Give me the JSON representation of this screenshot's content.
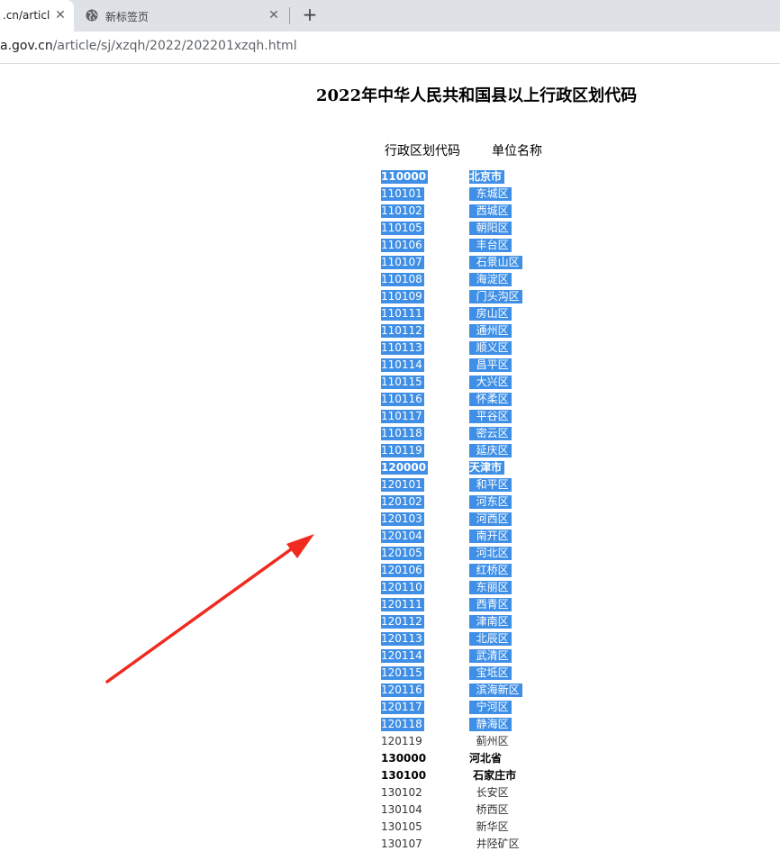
{
  "browser": {
    "tabs": [
      {
        "title": ".cn/articl",
        "active": true
      },
      {
        "title": "新标签页",
        "active": false
      }
    ],
    "new_tab_label": "+",
    "url_host": "a.gov.cn",
    "url_path": "/article/sj/xzqh/2022/202201xzqh.html"
  },
  "page": {
    "title": "2022年中华人民共和国县以上行政区划代码",
    "header_code": "行政区划代码",
    "header_name": "单位名称"
  },
  "rows": [
    {
      "code": "110000",
      "name": "北京市",
      "bold": true,
      "selected": true
    },
    {
      "code": "110101",
      "name": "  东城区",
      "bold": false,
      "selected": true
    },
    {
      "code": "110102",
      "name": "  西城区",
      "bold": false,
      "selected": true
    },
    {
      "code": "110105",
      "name": "  朝阳区",
      "bold": false,
      "selected": true
    },
    {
      "code": "110106",
      "name": "  丰台区",
      "bold": false,
      "selected": true
    },
    {
      "code": "110107",
      "name": "  石景山区",
      "bold": false,
      "selected": true
    },
    {
      "code": "110108",
      "name": "  海淀区",
      "bold": false,
      "selected": true
    },
    {
      "code": "110109",
      "name": "  门头沟区",
      "bold": false,
      "selected": true
    },
    {
      "code": "110111",
      "name": "  房山区",
      "bold": false,
      "selected": true
    },
    {
      "code": "110112",
      "name": "  通州区",
      "bold": false,
      "selected": true
    },
    {
      "code": "110113",
      "name": "  顺义区",
      "bold": false,
      "selected": true
    },
    {
      "code": "110114",
      "name": "  昌平区",
      "bold": false,
      "selected": true
    },
    {
      "code": "110115",
      "name": "  大兴区",
      "bold": false,
      "selected": true
    },
    {
      "code": "110116",
      "name": "  怀柔区",
      "bold": false,
      "selected": true
    },
    {
      "code": "110117",
      "name": "  平谷区",
      "bold": false,
      "selected": true
    },
    {
      "code": "110118",
      "name": "  密云区",
      "bold": false,
      "selected": true
    },
    {
      "code": "110119",
      "name": "  延庆区",
      "bold": false,
      "selected": true
    },
    {
      "code": "120000",
      "name": "天津市",
      "bold": true,
      "selected": true
    },
    {
      "code": "120101",
      "name": "  和平区",
      "bold": false,
      "selected": true
    },
    {
      "code": "120102",
      "name": "  河东区",
      "bold": false,
      "selected": true
    },
    {
      "code": "120103",
      "name": "  河西区",
      "bold": false,
      "selected": true
    },
    {
      "code": "120104",
      "name": "  南开区",
      "bold": false,
      "selected": true
    },
    {
      "code": "120105",
      "name": "  河北区",
      "bold": false,
      "selected": true
    },
    {
      "code": "120106",
      "name": "  红桥区",
      "bold": false,
      "selected": true
    },
    {
      "code": "120110",
      "name": "  东丽区",
      "bold": false,
      "selected": true
    },
    {
      "code": "120111",
      "name": "  西青区",
      "bold": false,
      "selected": true
    },
    {
      "code": "120112",
      "name": "  津南区",
      "bold": false,
      "selected": true
    },
    {
      "code": "120113",
      "name": "  北辰区",
      "bold": false,
      "selected": true
    },
    {
      "code": "120114",
      "name": "  武清区",
      "bold": false,
      "selected": true
    },
    {
      "code": "120115",
      "name": "  宝坻区",
      "bold": false,
      "selected": true
    },
    {
      "code": "120116",
      "name": "  滨海新区",
      "bold": false,
      "selected": true
    },
    {
      "code": "120117",
      "name": "  宁河区",
      "bold": false,
      "selected": true
    },
    {
      "code": "120118",
      "name": "  静海区",
      "bold": false,
      "selected": true
    },
    {
      "code": "120119",
      "name": "  蓟州区",
      "bold": false,
      "selected": false
    },
    {
      "code": "130000",
      "name": "河北省",
      "bold": true,
      "selected": false
    },
    {
      "code": "130100",
      "name": " 石家庄市",
      "bold": true,
      "selected": false
    },
    {
      "code": "130102",
      "name": "  长安区",
      "bold": false,
      "selected": false
    },
    {
      "code": "130104",
      "name": "  桥西区",
      "bold": false,
      "selected": false
    },
    {
      "code": "130105",
      "name": "  新华区",
      "bold": false,
      "selected": false
    },
    {
      "code": "130107",
      "name": "  井陉矿区",
      "bold": false,
      "selected": false
    }
  ],
  "colors": {
    "selection": "#3f8fe6",
    "annotation_arrow": "#f02a20"
  }
}
